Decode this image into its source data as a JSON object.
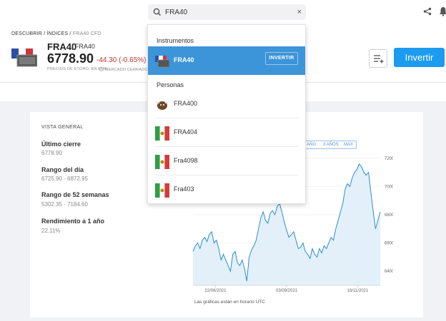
{
  "search": {
    "value": "FRA40",
    "placeholder": "",
    "clear_label": "×"
  },
  "header_icons": [
    "search-icon",
    "share-icon",
    "bell-icon"
  ],
  "breadcrumb": {
    "items": [
      "DESCUBRIR",
      "ÍNDICES",
      "FRA40 CFD"
    ],
    "separator": "/"
  },
  "instrument": {
    "symbol": "FRA40",
    "separator": "|",
    "name": "FRA40",
    "price": "6778.90",
    "change": "-44.30 (-0.65%)",
    "price_note": "PRECIOS DE ETORO, EN EUR",
    "market_status": "MERCADO CERRADO"
  },
  "actions": {
    "invest_label": "Invertir"
  },
  "overview": {
    "title": "VISTA GENERAL",
    "stats": [
      {
        "label": "Último cierre",
        "value": "6778.90"
      },
      {
        "label": "Rango del día",
        "value": "6725.90 - 6872.95"
      },
      {
        "label": "Rango de 52 semanas",
        "value": "5302.35 - 7184.60"
      },
      {
        "label": "Rendimiento a 1 año",
        "value": "22.11%"
      }
    ]
  },
  "range_tabs": [
    "AÑO",
    "3 AÑOS",
    "MAX"
  ],
  "chart_note": "Las gráficas están en horario UTC",
  "colors": {
    "accent": "#1c9bf0",
    "dropdown_active": "#3c94d9",
    "negative": "#c0392b",
    "chart_line": "#2a8fd0",
    "chart_fill": "#e3f0fa"
  },
  "dropdown": {
    "instruments_title": "Instrumentos",
    "instruments": [
      {
        "name": "FRA40",
        "action": "INVERTIR",
        "icon": "fra40-flag-icon"
      }
    ],
    "people_title": "Personas",
    "people": [
      {
        "name": "FRA400",
        "icon": "bull-avatar-icon"
      },
      {
        "name": "FRA404",
        "icon": "flag-avatar-icon"
      },
      {
        "name": "Fra4098",
        "icon": "flag-avatar-icon"
      },
      {
        "name": "Fra403",
        "icon": "flag-avatar-icon"
      }
    ]
  },
  "chart_data": {
    "type": "area",
    "x_tick_labels": [
      "22/06/2021",
      "03/09/2021",
      "16/11/2021"
    ],
    "y_tick_labels": [
      "6400.00",
      "6600.00",
      "6800.00",
      "7000.00",
      "7200.00"
    ],
    "ylim": [
      6300,
      7250
    ],
    "grid": true,
    "x": [
      0,
      1,
      2,
      3,
      4,
      5,
      6,
      7,
      8,
      9,
      10,
      11,
      12,
      13,
      14,
      15,
      16,
      17,
      18,
      19,
      20,
      21,
      22,
      23,
      24,
      25,
      26,
      27,
      28,
      29,
      30,
      31,
      32,
      33,
      34,
      35,
      36,
      37,
      38,
      39,
      40,
      41,
      42,
      43,
      44,
      45,
      46,
      47,
      48,
      49,
      50,
      51,
      52,
      53,
      54,
      55,
      56,
      57,
      58,
      59,
      60,
      61,
      62,
      63,
      64,
      65,
      66,
      67,
      68,
      69,
      70,
      71,
      72,
      73,
      74,
      75,
      76,
      77,
      78,
      79,
      80
    ],
    "values": [
      6540,
      6580,
      6600,
      6560,
      6620,
      6640,
      6610,
      6660,
      6680,
      6600,
      6620,
      6560,
      6480,
      6520,
      6480,
      6440,
      6400,
      6520,
      6540,
      6460,
      6440,
      6480,
      6420,
      6330,
      6500,
      6550,
      6580,
      6620,
      6700,
      6780,
      6820,
      6760,
      6740,
      6810,
      6830,
      6800,
      6860,
      6880,
      6820,
      6750,
      6690,
      6640,
      6660,
      6680,
      6620,
      6560,
      6570,
      6600,
      6540,
      6520,
      6490,
      6560,
      6520,
      6500,
      6560,
      6530,
      6580,
      6560,
      6600,
      6640,
      6620,
      6700,
      6760,
      6820,
      6880,
      6980,
      7020,
      7000,
      7060,
      7100,
      7120,
      7160,
      7140,
      7100,
      7080,
      7100,
      6960,
      6820,
      6700,
      6760,
      6820
    ]
  }
}
